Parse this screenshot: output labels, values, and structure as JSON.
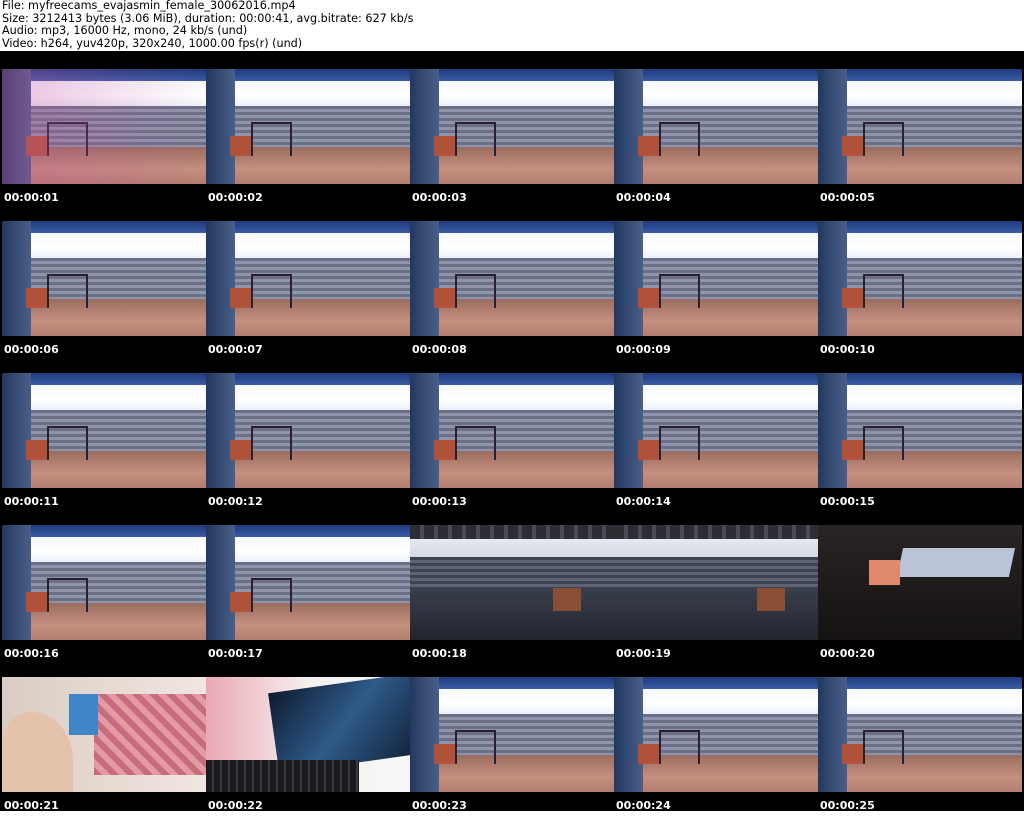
{
  "header": {
    "line1": "File: myfreecams_evajasmin_female_30062016.mp4",
    "line2": "Size: 3212413 bytes (3.06 MiB), duration: 00:00:41, avg.bitrate: 627 kb/s",
    "line3": "Audio: mp3, 16000 Hz, mono, 24 kb/s (und)",
    "line4": "Video: h264, yuv420p, 320x240, 1000.00 fps(r) (und)"
  },
  "thumbnails": [
    {
      "time": "00:00:01",
      "scene": "wall-pink"
    },
    {
      "time": "00:00:02",
      "scene": "wall"
    },
    {
      "time": "00:00:03",
      "scene": "wall"
    },
    {
      "time": "00:00:04",
      "scene": "wall"
    },
    {
      "time": "00:00:05",
      "scene": "wall"
    },
    {
      "time": "00:00:06",
      "scene": "wall"
    },
    {
      "time": "00:00:07",
      "scene": "wall"
    },
    {
      "time": "00:00:08",
      "scene": "wall"
    },
    {
      "time": "00:00:09",
      "scene": "wall"
    },
    {
      "time": "00:00:10",
      "scene": "wall"
    },
    {
      "time": "00:00:11",
      "scene": "wall"
    },
    {
      "time": "00:00:12",
      "scene": "wall"
    },
    {
      "time": "00:00:13",
      "scene": "wall"
    },
    {
      "time": "00:00:14",
      "scene": "wall"
    },
    {
      "time": "00:00:15",
      "scene": "wall"
    },
    {
      "time": "00:00:16",
      "scene": "wall"
    },
    {
      "time": "00:00:17",
      "scene": "wall"
    },
    {
      "time": "00:00:18",
      "scene": "dark"
    },
    {
      "time": "00:00:19",
      "scene": "dark"
    },
    {
      "time": "00:00:20",
      "scene": "black"
    },
    {
      "time": "00:00:21",
      "scene": "person"
    },
    {
      "time": "00:00:22",
      "scene": "laptop"
    },
    {
      "time": "00:00:23",
      "scene": "wall"
    },
    {
      "time": "00:00:24",
      "scene": "wall"
    },
    {
      "time": "00:00:25",
      "scene": "wall"
    }
  ],
  "colors": {
    "sheet_background": "#000000",
    "timestamp_text": "#ffffff",
    "header_text": "#000000"
  }
}
